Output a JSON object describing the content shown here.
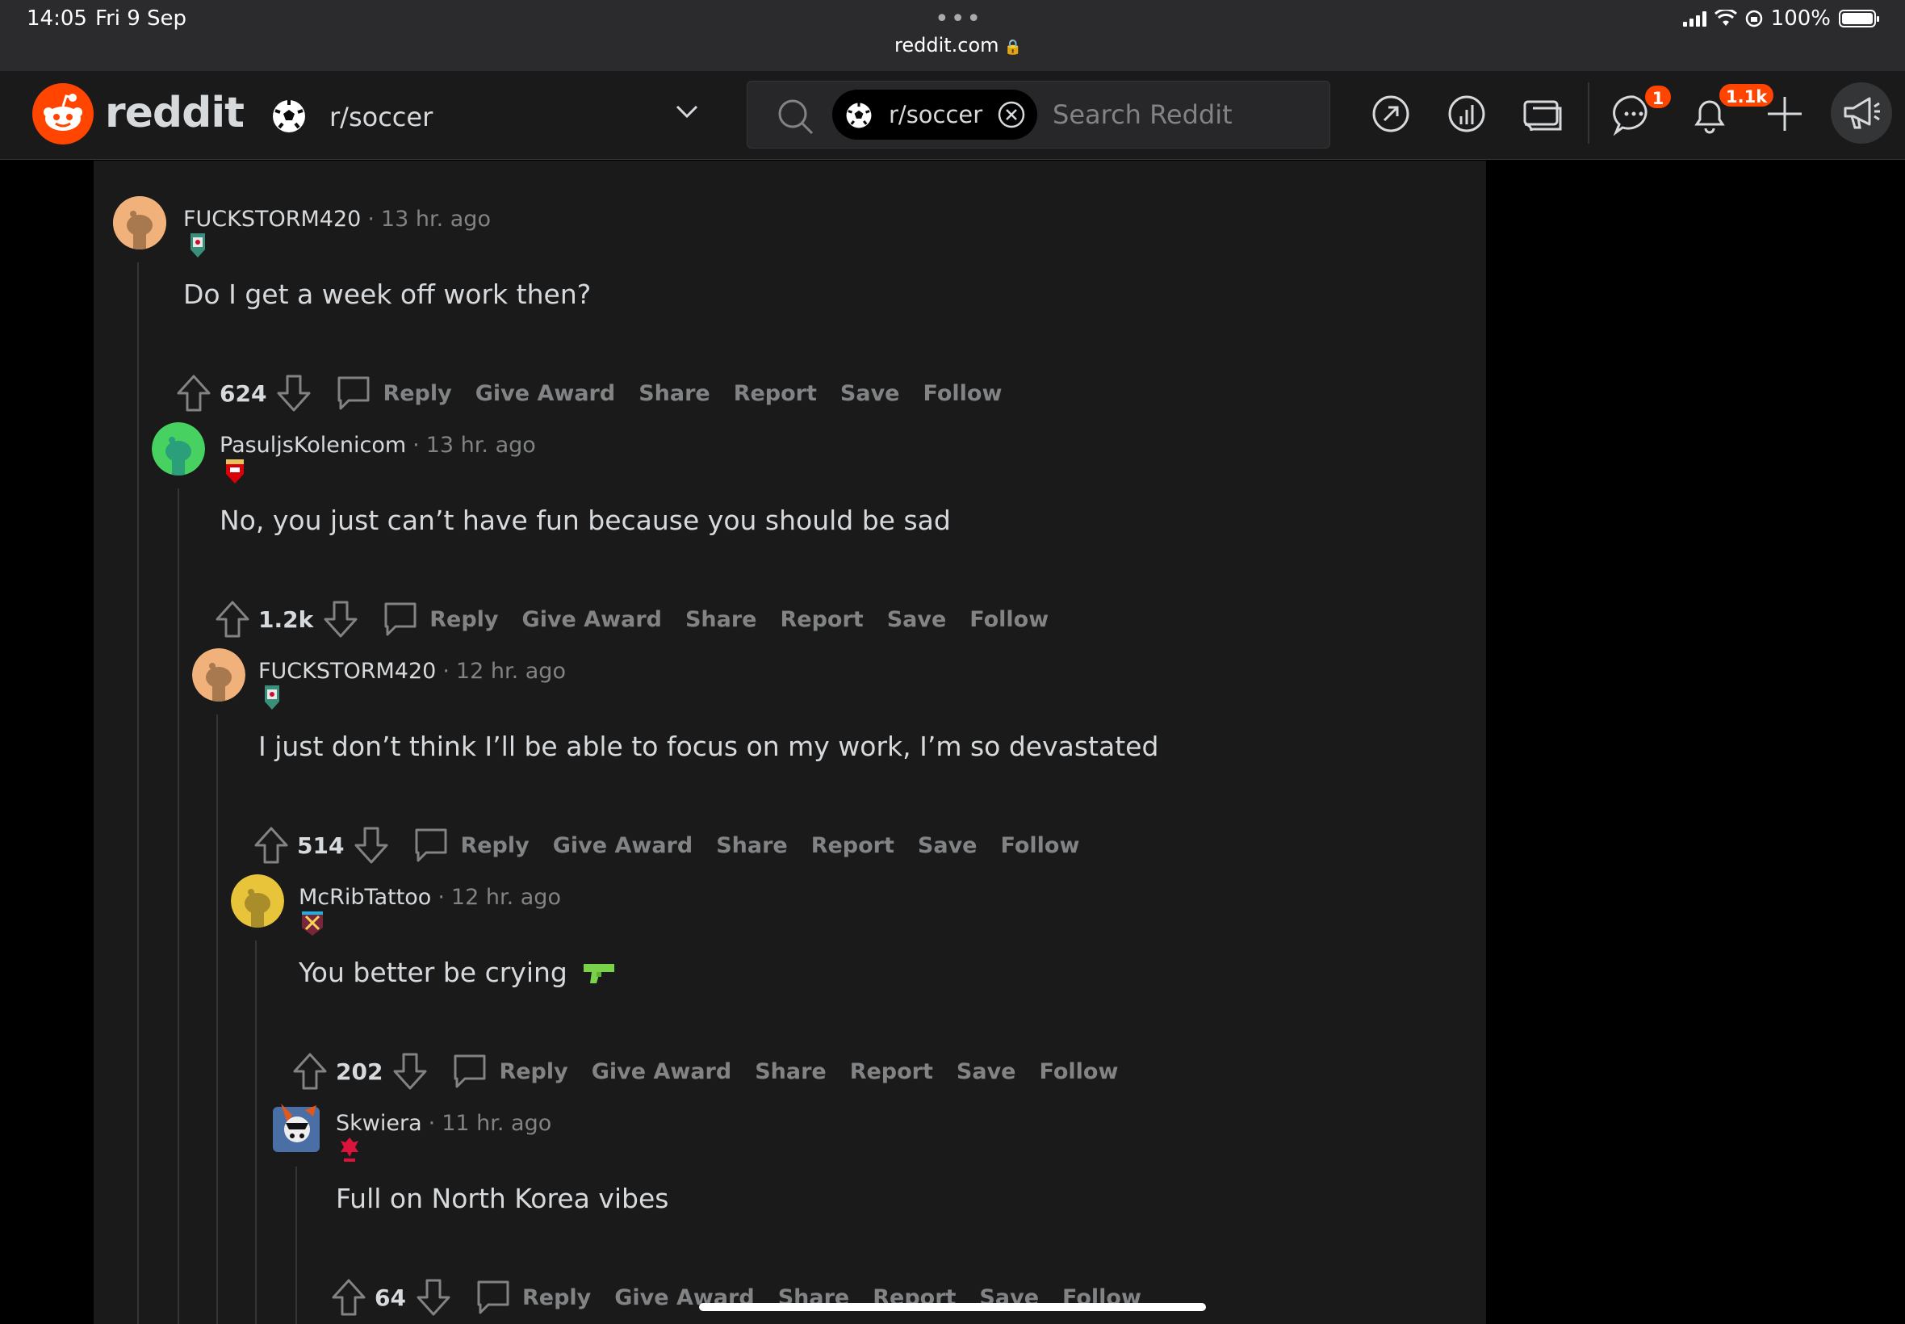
{
  "status_bar": {
    "time": "14:05",
    "date": "Fri 9 Sep",
    "url": "reddit.com",
    "battery": "100%"
  },
  "header": {
    "wordmark": "reddit",
    "subreddit": "r/soccer",
    "search_chip": "r/soccer",
    "search_placeholder": "Search Reddit",
    "chat_badge": "1",
    "notif_badge": "1.1k"
  },
  "colors": {
    "brand": "#ff4500",
    "background": "#1a1a1b",
    "muted": "#818384",
    "text": "#d7dadc"
  },
  "actions_labels": {
    "reply": "Reply",
    "give_award": "Give Award",
    "share": "Share",
    "report": "Report",
    "save": "Save",
    "follow": "Follow"
  },
  "comments": [
    {
      "author": "FUCKSTORM420",
      "time": "13 hr. ago",
      "flair": "liverpool-crest-icon",
      "body": "Do I get a week off work then?",
      "votes": "624"
    },
    {
      "author": "PasuljsKolenicom",
      "time": "13 hr. ago",
      "flair": "arsenal-crest-icon",
      "body": "No, you just can’t have fun because you should be sad",
      "votes": "1.2k"
    },
    {
      "author": "FUCKSTORM420",
      "time": "12 hr. ago",
      "flair": "liverpool-crest-icon",
      "body": "I just don’t think I’ll be able to focus on my work, I’m so devastated",
      "votes": "514"
    },
    {
      "author": "McRibTattoo",
      "time": "12 hr. ago",
      "flair": "west-ham-crest-icon",
      "body": "You better be crying",
      "votes": "202"
    },
    {
      "author": "Skwiera",
      "time": "11 hr. ago",
      "flair": "poland-crest-icon",
      "body": "Full on North Korea vibes",
      "votes": "64"
    }
  ]
}
